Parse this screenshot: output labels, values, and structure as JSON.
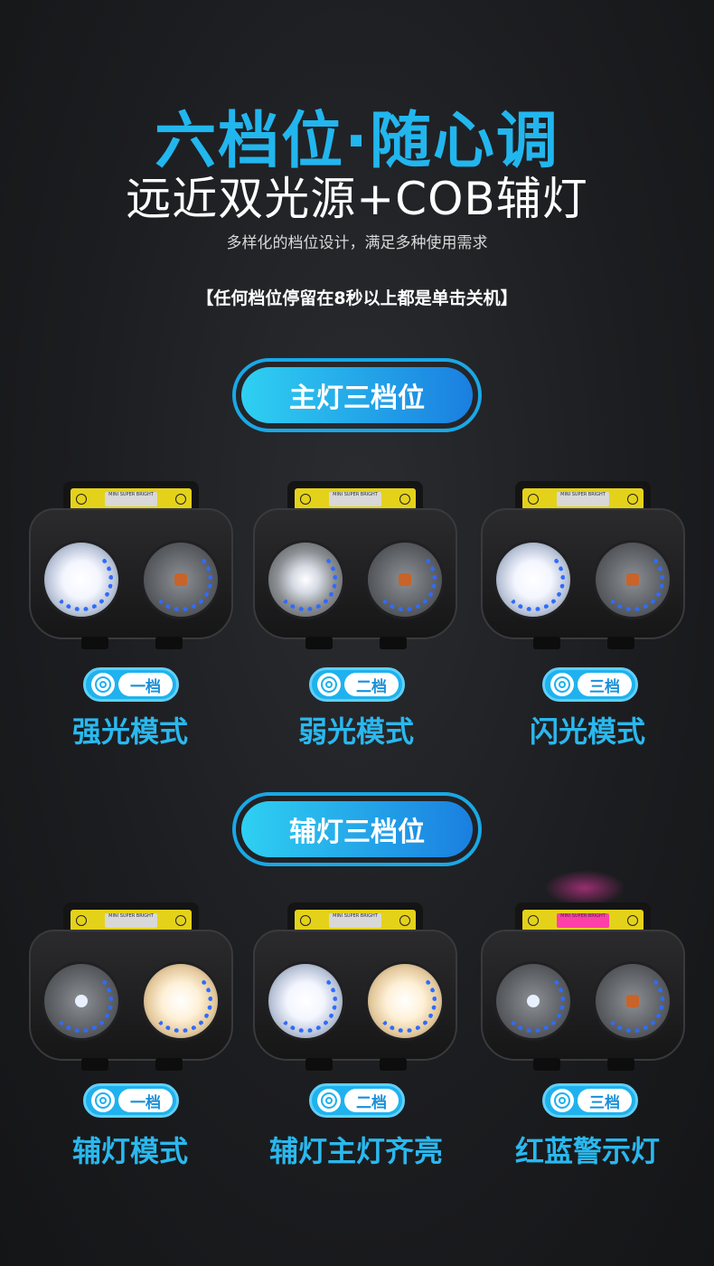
{
  "header": {
    "title": "六档位·随心调",
    "subtitle": "远近双光源+COB辅灯",
    "description": "多样化的档位设计，满足多种使用需求",
    "note": "【任何档位停留在8秒以上都是单击关机】"
  },
  "sections": [
    {
      "label": "主灯三档位",
      "items": [
        {
          "level": "一档",
          "mode": "强光模式",
          "icon": "fingerprint-icon"
        },
        {
          "level": "二档",
          "mode": "弱光模式",
          "icon": "fingerprint-icon"
        },
        {
          "level": "三档",
          "mode": "闪光模式",
          "icon": "fingerprint-icon"
        }
      ]
    },
    {
      "label": "辅灯三档位",
      "items": [
        {
          "level": "一档",
          "mode": "辅灯模式",
          "icon": "fingerprint-icon"
        },
        {
          "level": "二档",
          "mode": "辅灯主灯齐亮",
          "icon": "fingerprint-icon"
        },
        {
          "level": "三档",
          "mode": "红蓝警示灯",
          "icon": "fingerprint-icon"
        }
      ]
    }
  ],
  "product_strip_text": "MINI SUPER BRIGHT",
  "colors": {
    "accent": "#22b6ee",
    "button_gradient_start": "#2fd0f2",
    "button_gradient_end": "#1a7fe0",
    "background": "#1c1d20"
  }
}
